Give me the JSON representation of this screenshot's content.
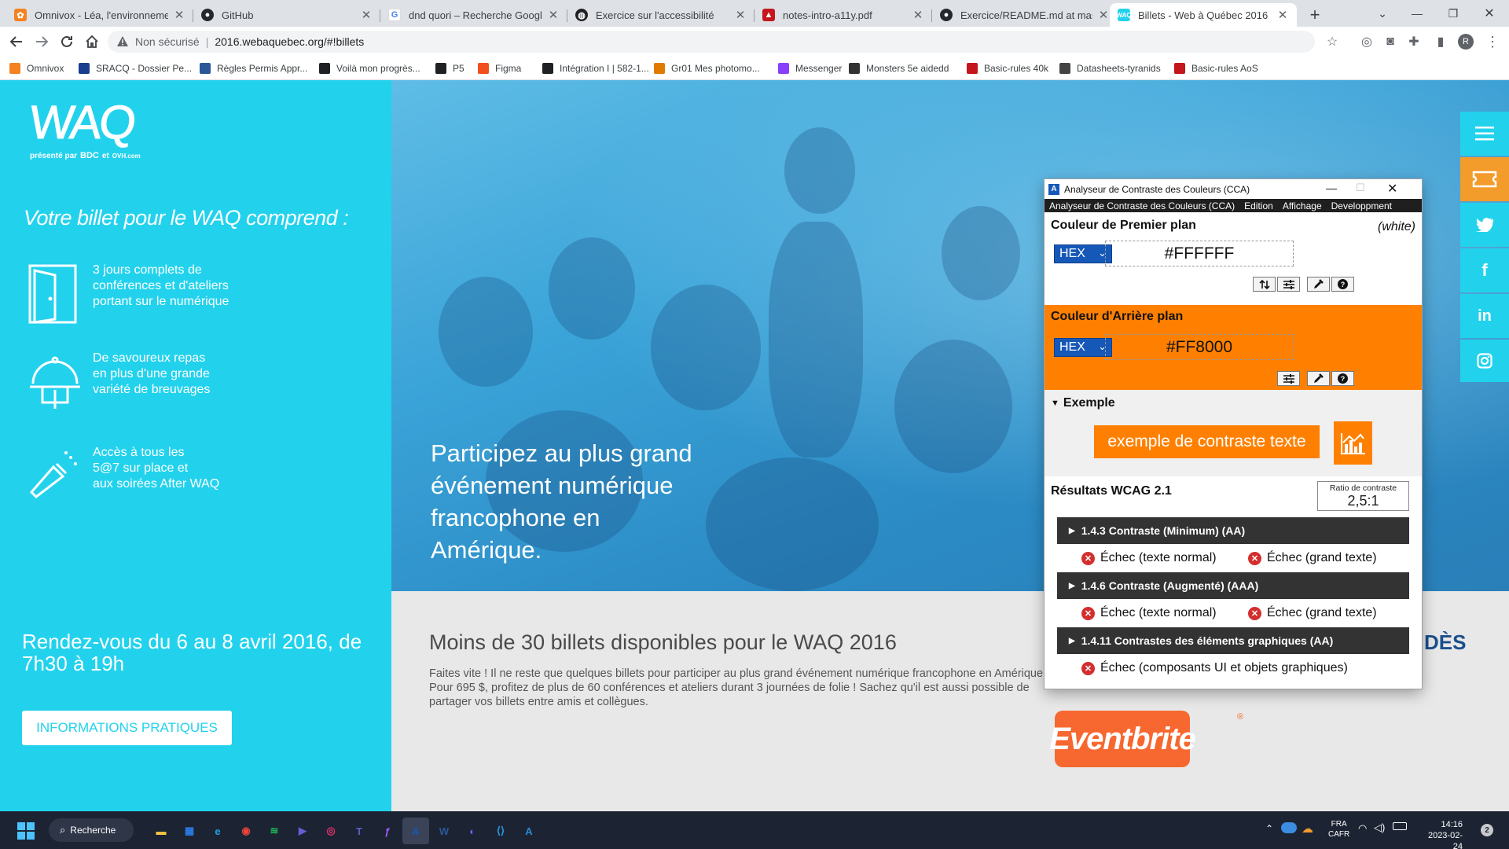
{
  "browser": {
    "tabs": [
      {
        "title": "Omnivox - Léa, l'environnement",
        "icon": "omnivox-icon",
        "color": "#f58220"
      },
      {
        "title": "GitHub",
        "icon": "github-icon",
        "color": "#24292f"
      },
      {
        "title": "dnd quori – Recherche Google",
        "icon": "google-icon",
        "color": "#4285f4"
      },
      {
        "title": "Exercice sur l'accessibilité",
        "icon": "globe-icon",
        "color": "#202124"
      },
      {
        "title": "notes-intro-a11y.pdf",
        "icon": "pdf-icon",
        "color": "#c4161c"
      },
      {
        "title": "Exercice/README.md at master",
        "icon": "github-icon",
        "color": "#24292f"
      },
      {
        "title": "Billets - Web à Québec 2016",
        "icon": "waq-icon",
        "color": "#22d2ed"
      }
    ],
    "new_tab": "+",
    "address": {
      "security": "Non sécurisé",
      "url": "2016.webaquebec.org/#!billets"
    },
    "profile_initial": "R",
    "bookmarks": [
      {
        "label": "Omnivox",
        "color": "#f58220"
      },
      {
        "label": "SRACQ - Dossier Pe...",
        "color": "#1a3d8f"
      },
      {
        "label": "Règles Permis Appr...",
        "color": "#2b5797"
      },
      {
        "label": "Voilà mon progrès...",
        "color": "#202124"
      },
      {
        "label": "P5",
        "color": "#202124"
      },
      {
        "label": "Figma",
        "color": "#f24e1e"
      },
      {
        "label": "Intégration I | 582-1...",
        "color": "#202124"
      },
      {
        "label": "Gr01 Mes photomo...",
        "color": "#e07b00"
      },
      {
        "label": "Messenger",
        "color": "#8a3ffc"
      },
      {
        "label": "Monsters 5e aidedd",
        "color": "#333333"
      },
      {
        "label": "Basic-rules 40k",
        "color": "#c4161c"
      },
      {
        "label": "Datasheets-tyranids",
        "color": "#444444"
      },
      {
        "label": "Basic-rules AoS",
        "color": "#c4161c"
      }
    ]
  },
  "waq": {
    "logo": "WAQ",
    "presented_by": "présenté par",
    "sponsor_1": "BDC",
    "sponsor_and": "et",
    "sponsor_2": "OVH.com",
    "includes_title": "Votre billet pour le WAQ comprend :",
    "features": [
      {
        "icon": "door-icon",
        "text": "3 jours complets de\nconférences et d'ateliers\nportant sur le numérique"
      },
      {
        "icon": "meal-cloche-icon",
        "text": "De savoureux repas\nen plus d'une grande\nvariété de breuvages"
      },
      {
        "icon": "champagne-icon",
        "text": "Accès à tous les\n5@7 sur place et\naux soirées After WAQ"
      }
    ],
    "dates": "Rendez-vous du 6 au 8 avril 2016, de 7h30 à 19h",
    "info_button": "INFORMATIONS PRATIQUES",
    "hero_text": "Participez au plus grand événement numérique francophone en Amérique.",
    "tickets_title": "Moins de 30 billets disponibles pour le WAQ 2016",
    "tickets_body": "Faites vite ! Il ne reste que quelques billets pour participer au plus grand événement numérique francophone en Amérique. Pour 695 $, profitez de plus de 60 conférences et ateliers durant 3 journées de folie ! Sachez qu'il est aussi possible de partager vos billets entre amis et collègues.",
    "partial_text": "DÈS",
    "eventbrite": "Eventbrite",
    "eventbrite_mark": "®",
    "social": [
      "menu-icon",
      "ticket-icon",
      "twitter-icon",
      "facebook-icon",
      "linkedin-icon",
      "instagram-icon"
    ]
  },
  "cca": {
    "window_title": "Analyseur de Contraste des Couleurs (CCA)",
    "menu": [
      "Analyseur de Contraste des Couleurs (CCA)",
      "Edition",
      "Affichage",
      "Developpment"
    ],
    "fg_label": "Couleur de Premier plan",
    "fg_name": "(white)",
    "fg_format": "HEX",
    "fg_value": "#FFFFFF",
    "bg_label": "Couleur d'Arrière plan",
    "bg_format": "HEX",
    "bg_value": "#FF8000",
    "bg_color": "#FF8000",
    "sample_title": "Exemple",
    "sample_text": "exemple de contraste texte",
    "results_title": "Résultats WCAG 2.1",
    "ratio_label": "Ratio de contraste",
    "ratio_value": "2,5:1",
    "criteria": [
      {
        "title": "1.4.3 Contraste (Minimum) (AA)",
        "results": [
          "Échec (texte normal)",
          "Échec (grand texte)"
        ]
      },
      {
        "title": "1.4.6 Contraste (Augmenté) (AAA)",
        "results": [
          "Échec (texte normal)",
          "Échec (grand texte)"
        ]
      },
      {
        "title": "1.4.11 Contrastes des éléments graphiques (AA)",
        "results": [
          "Échec (composants UI et objets graphiques)"
        ]
      }
    ]
  },
  "taskbar": {
    "search_label": "Recherche",
    "lang_1": "FRA",
    "lang_2": "CAFR",
    "time": "14:16",
    "date": "2023-02-24",
    "notification_count": "2",
    "apps": [
      "file-explorer-icon",
      "microsoft-store-icon",
      "edge-icon",
      "chrome-icon",
      "spotify-icon",
      "clipchamp-icon",
      "instagram-app-icon",
      "teams-icon",
      "figma-icon",
      "cca-app-icon",
      "word-icon",
      "discord-icon",
      "vscode-icon",
      "cca-app-2-icon"
    ]
  }
}
